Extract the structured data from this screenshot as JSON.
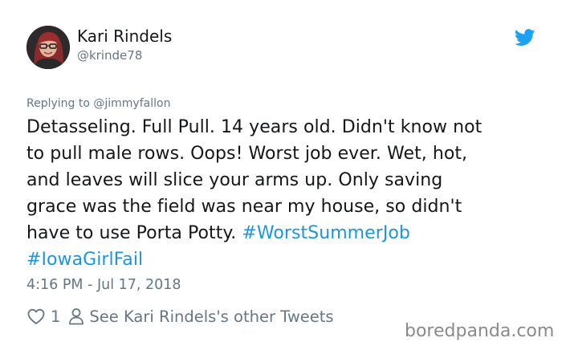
{
  "author": {
    "display_name": "Kari Rindels",
    "handle": "@krinde78"
  },
  "reply_to": "Replying to @jimmyfallon",
  "tweet": {
    "lines": [
      "Detasseling. Full Pull. 14 years old. Didn't know not",
      "to pull male rows. Oops! Worst job ever. Wet, hot,",
      "and leaves will slice your arms up. Only saving",
      "grace was the field was near my house, so didn't"
    ],
    "line5_text": "have to use Porta Potty. ",
    "hashtags": [
      "#WorstSummerJob",
      "#IowaGirlFail"
    ],
    "timestamp": "4:16 PM - Jul 17, 2018"
  },
  "actions": {
    "like_count": "1",
    "profile_link": "See Kari Rindels's other Tweets"
  },
  "icons": {
    "brand": "twitter-bird-icon",
    "like": "heart-icon",
    "profile": "person-icon"
  },
  "colors": {
    "twitter_blue": "#1da1f2",
    "hashtag_blue": "#1b95e0",
    "secondary_gray": "#657786",
    "text": "#14171a"
  },
  "watermark": "boredpanda.com"
}
